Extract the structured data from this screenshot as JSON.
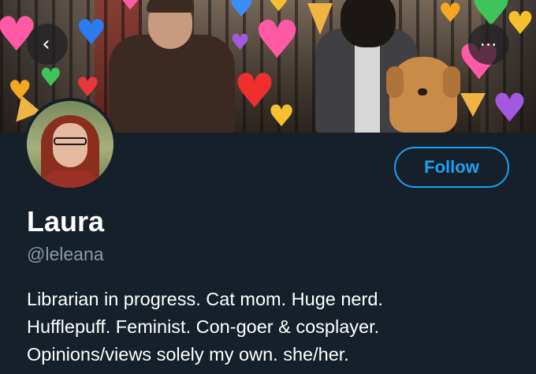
{
  "profile": {
    "name": "Laura",
    "handle": "@leleana",
    "bio_lines": [
      "Librarian in progress. Cat mom. Huge nerd.",
      "Hufflepuff. Feminist. Con-goer & cosplayer.",
      "Opinions/views solely my own. she/her."
    ]
  },
  "actions": {
    "follow_label": "Follow",
    "back_icon": "chevron-left-icon",
    "more_icon": "more-options-icon"
  },
  "icons": {
    "back_glyph": "‹",
    "more_glyph": "…",
    "heart_glyph": "♥"
  },
  "colors": {
    "background": "#15202b",
    "accent": "#1da1f2",
    "secondary_text": "#8899a6",
    "primary_text": "#ffffff"
  }
}
